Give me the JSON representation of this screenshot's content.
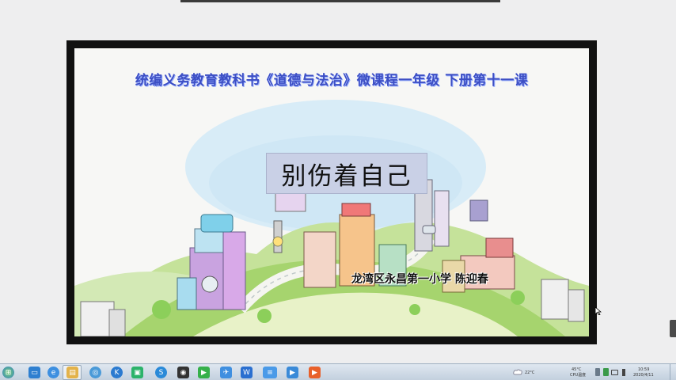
{
  "slide": {
    "series_title": "统编义务教育教科书《道德与法治》微课程一年级  下册第十一课",
    "lesson_title": "别伤着自己",
    "author": "龙湾区永昌第一小学 陈迎春"
  },
  "taskbar": {
    "weather": "22°C",
    "cpu_temp": "45°C",
    "cpu_label": "CPU温度",
    "time": "10:59",
    "date": "2020/4/11"
  },
  "colors": {
    "title_blue": "#3d4fc4",
    "title_box": "#c9d0e6",
    "frame": "#111111"
  }
}
